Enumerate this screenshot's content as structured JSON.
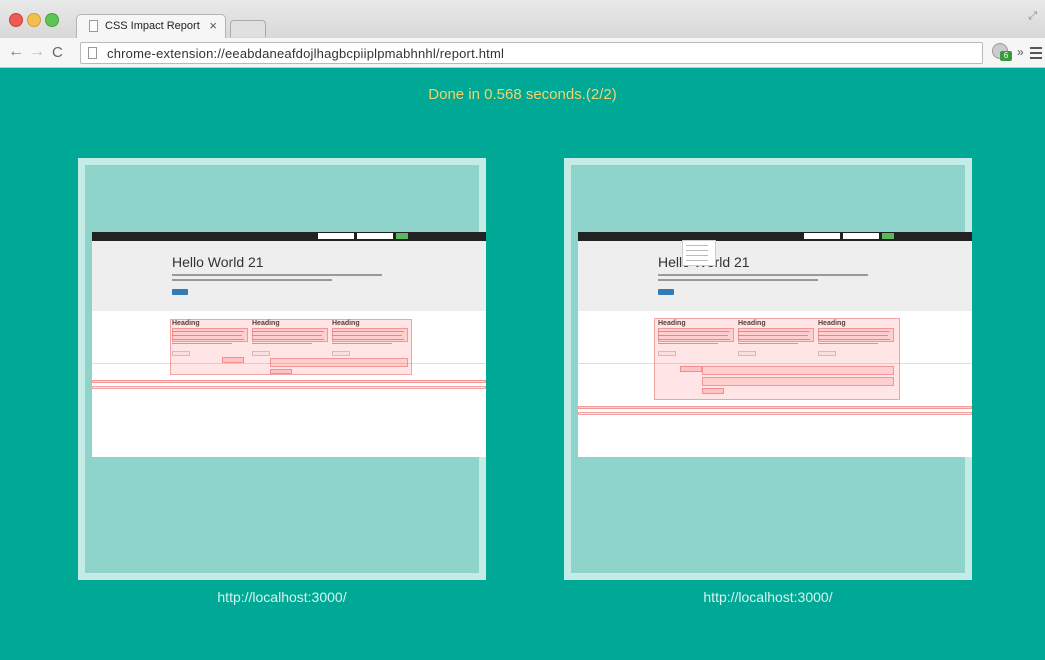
{
  "browser": {
    "tab_title": "CSS Impact Report",
    "tab_close": "×",
    "url": "chrome-extension://eeabdaneafdojlhagbcpiiplpmabhnhl/report.html",
    "extension_badge": "6",
    "overflow": "»"
  },
  "report": {
    "status": "Done in 0.568 seconds.(2/2)"
  },
  "panels": [
    {
      "caption": "http://localhost:3000/",
      "heading": "Hello World 21",
      "columns": [
        "Heading",
        "Heading",
        "Heading"
      ]
    },
    {
      "caption": "http://localhost:3000/",
      "heading": "Hello World 21",
      "columns": [
        "Heading",
        "Heading",
        "Heading"
      ]
    }
  ]
}
